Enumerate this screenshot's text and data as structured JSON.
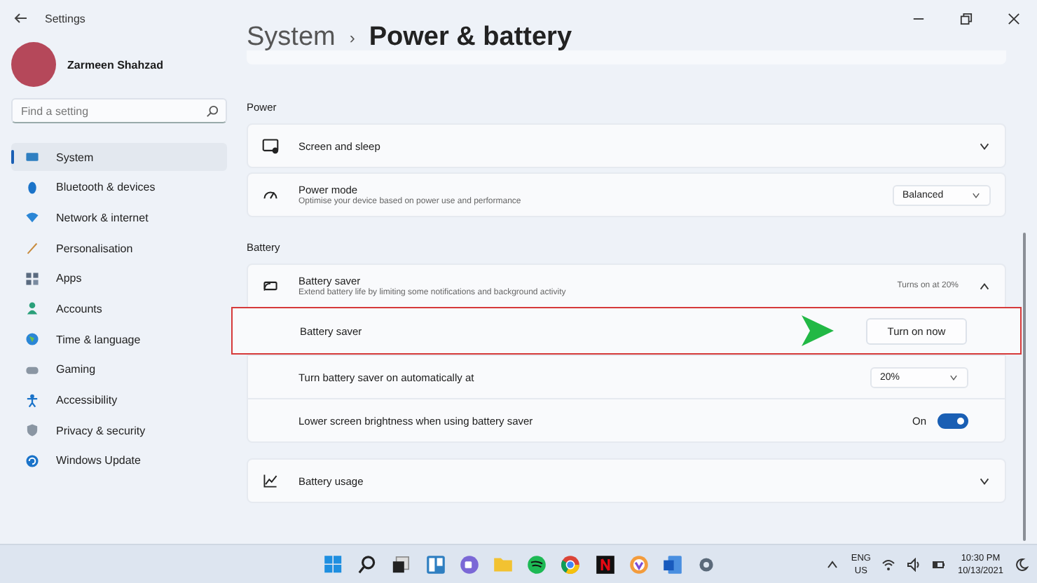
{
  "window": {
    "title": "Settings"
  },
  "profile": {
    "name": "Zarmeen Shahzad"
  },
  "search": {
    "placeholder": "Find a setting"
  },
  "sidebar": {
    "items": [
      {
        "label": "System",
        "selected": true
      },
      {
        "label": "Bluetooth & devices",
        "selected": false
      },
      {
        "label": "Network & internet",
        "selected": false
      },
      {
        "label": "Personalisation",
        "selected": false
      },
      {
        "label": "Apps",
        "selected": false
      },
      {
        "label": "Accounts",
        "selected": false
      },
      {
        "label": "Time & language",
        "selected": false
      },
      {
        "label": "Gaming",
        "selected": false
      },
      {
        "label": "Accessibility",
        "selected": false
      },
      {
        "label": "Privacy & security",
        "selected": false
      },
      {
        "label": "Windows Update",
        "selected": false
      }
    ]
  },
  "breadcrumb": {
    "parent": "System",
    "separator": "›",
    "current": "Power & battery"
  },
  "sections": [
    {
      "title": "Power",
      "cards": [
        {
          "kind": "expander",
          "title": "Screen and sleep",
          "expanded": false
        },
        {
          "kind": "dropdown",
          "title": "Power mode",
          "description": "Optimise your device based on power use and performance",
          "value": "Balanced"
        }
      ]
    },
    {
      "title": "Battery",
      "cards": [
        {
          "kind": "expander",
          "title": "Battery saver",
          "description": "Extend battery life by limiting some notifications and background activity",
          "status": "Turns on at 20%",
          "expanded": true,
          "rows": [
            {
              "kind": "button",
              "label": "Battery saver",
              "button": "Turn on now",
              "highlighted": true
            },
            {
              "kind": "dropdown",
              "label": "Turn battery saver on automatically at",
              "value": "20%",
              "highlighted": false
            },
            {
              "kind": "toggle",
              "label": "Lower screen brightness when using battery saver",
              "state_label": "On",
              "on": true,
              "highlighted": false
            }
          ]
        },
        {
          "kind": "expander",
          "title": "Battery usage",
          "expanded": false
        }
      ]
    }
  ],
  "taskbar": {
    "language": "ENG",
    "region": "US",
    "time": "10:30 PM",
    "date": "10/13/2021"
  }
}
